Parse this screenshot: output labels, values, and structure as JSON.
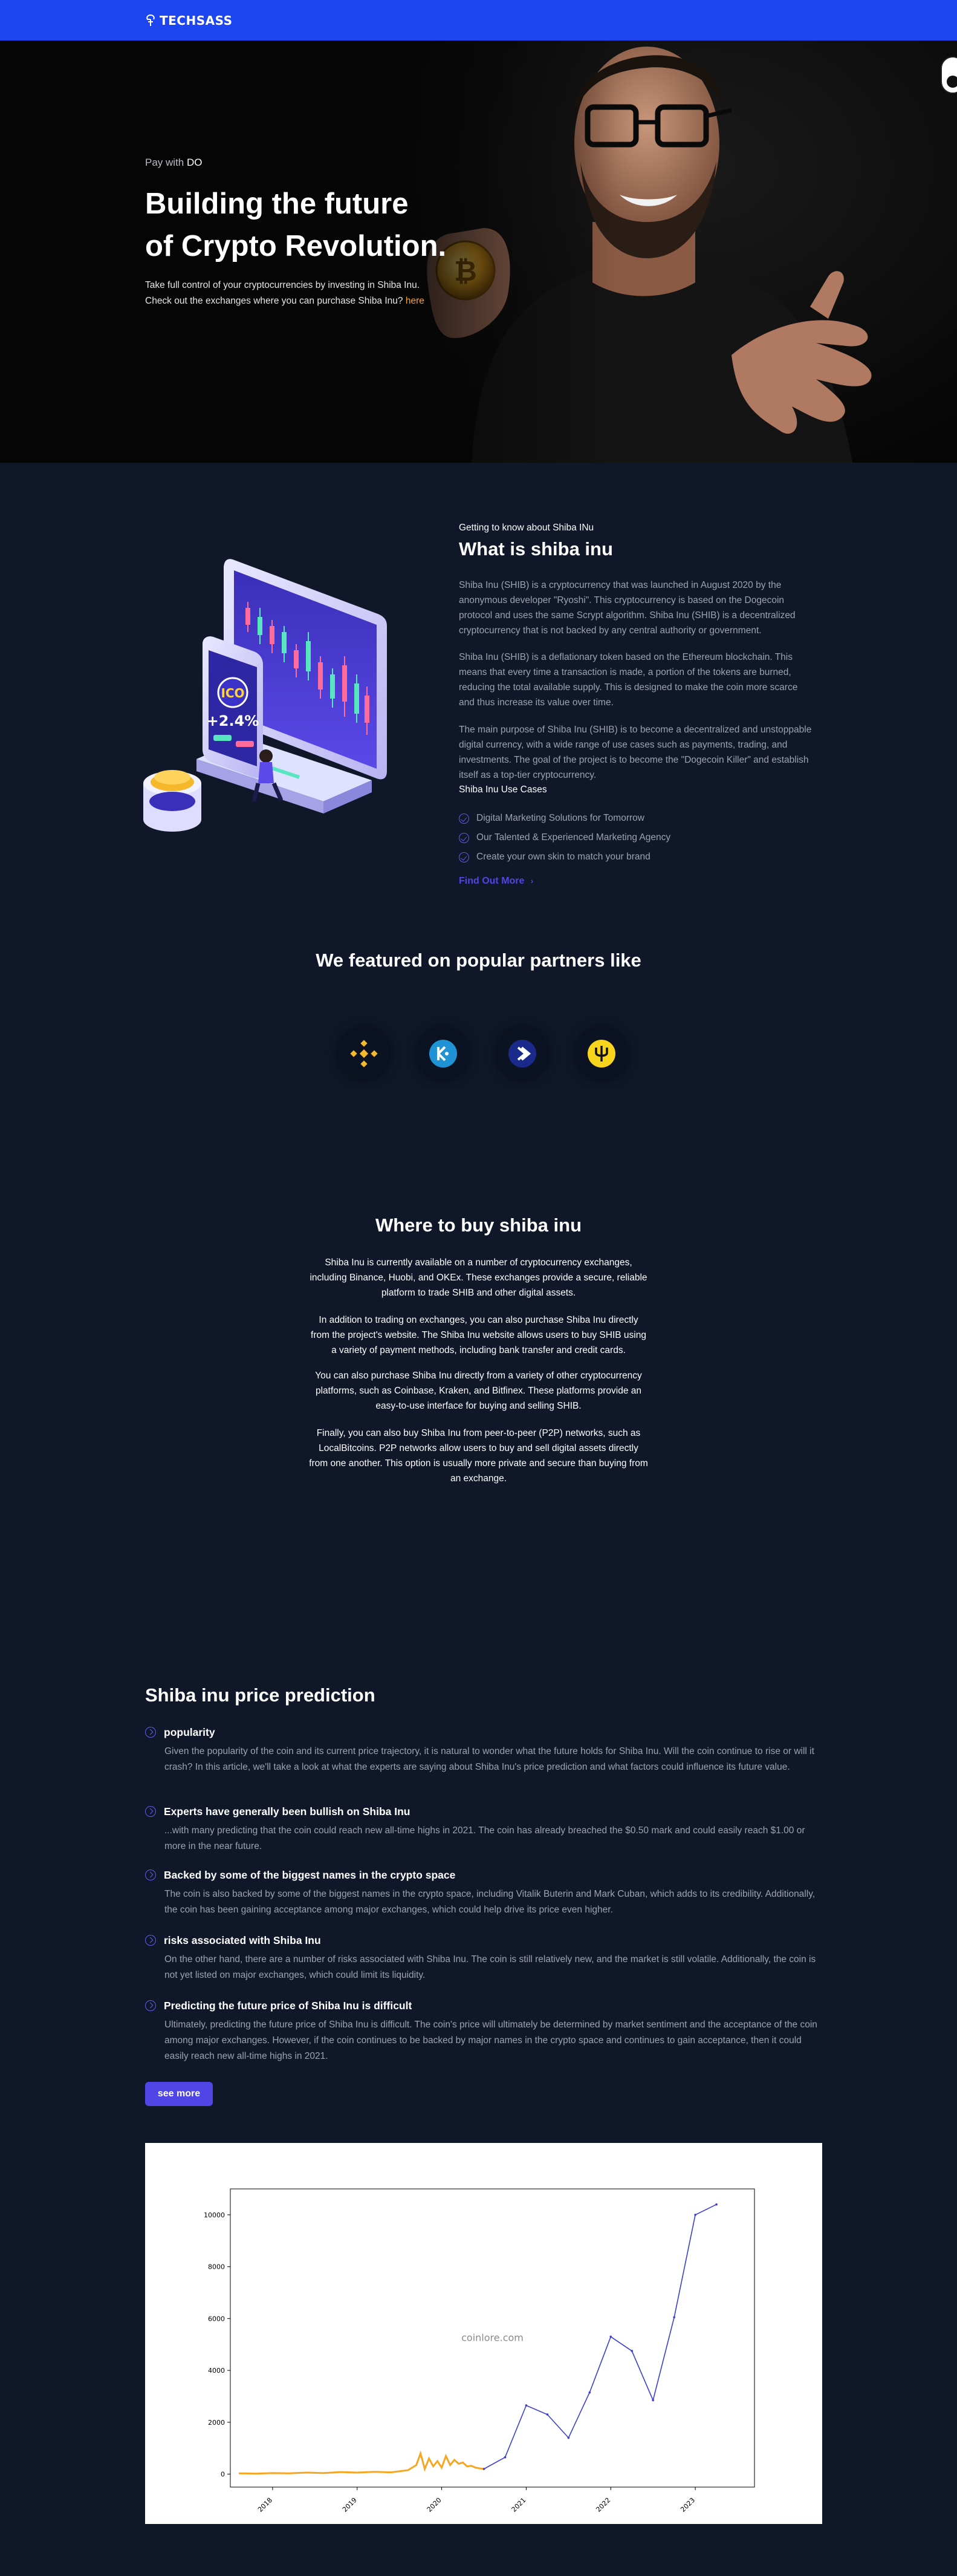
{
  "nav": {
    "brand": "TECHSASS",
    "brand_color": "#1e46f0"
  },
  "hero": {
    "pre_label": "Pay with ",
    "pre_highlight": "DO",
    "title_line1": "Building the future",
    "title_line2": "of Crypto Revolution.",
    "subtitle_line1": "Take full control of your cryptocurrencies by investing in Shiba Inu.",
    "subtitle_line2": "Check out the exchanges where you can purchase Shiba Inu? ",
    "subtitle_link": "here"
  },
  "about": {
    "kicker": "Getting to know about Shiba INu",
    "title": "What is shiba inu",
    "paragraphs": [
      "Shiba Inu (SHIB) is a cryptocurrency that was launched in August 2020 by the anonymous developer \"Ryoshi\". This cryptocurrency is based on the Dogecoin protocol and uses the same Scrypt algorithm. Shiba Inu (SHIB) is a decentralized cryptocurrency that is not backed by any central authority or government.",
      "Shiba Inu (SHIB) is a deflationary token based on the Ethereum blockchain. This means that every time a transaction is made, a portion of the tokens are burned, reducing the total available supply. This is designed to make the coin more scarce and thus increase its value over time.",
      "The main purpose of Shiba Inu (SHIB) is to become a decentralized and unstoppable digital currency, with a wide range of use cases such as payments, trading, and investments. The goal of the project is to become the \"Dogecoin Killer\" and establish itself as a top-tier cryptocurrency."
    ],
    "uses_title": "Shiba Inu Use Cases",
    "uses": [
      "Digital Marketing Solutions for Tomorrow",
      "Our Talented & Experienced Marketing Agency",
      "Create your own skin to match your brand"
    ],
    "find_more": "Find Out More",
    "illustration_badge": "ICO",
    "illustration_percent": "+2.4%"
  },
  "partners": {
    "title": "We featured on popular partners like",
    "items": [
      {
        "name": "binance-icon",
        "color": "#f3ba2f"
      },
      {
        "name": "kucoin-icon",
        "color": "#1f93d6"
      },
      {
        "name": "exchange-chevron-icon",
        "color": "#1a2a8a"
      },
      {
        "name": "trident-icon",
        "color": "#f6d51c"
      }
    ]
  },
  "buy": {
    "title": "Where to buy shiba inu",
    "paragraphs": [
      "Shiba Inu is currently available on a number of cryptocurrency exchanges, including Binance, Huobi, and OKEx. These exchanges provide a secure, reliable platform to trade SHIB and other digital assets.",
      "In addition to trading on exchanges, you can also purchase Shiba Inu directly from the project's website. The Shiba Inu website allows users to buy SHIB using a variety of payment methods, including bank transfer and credit cards.",
      "You can also purchase Shiba Inu directly from a variety of other cryptocurrency platforms, such as Coinbase, Kraken, and Bitfinex. These platforms provide an easy-to-use interface for buying and selling SHIB.",
      "Finally, you can also buy Shiba Inu from peer-to-peer (P2P) networks, such as LocalBitcoins. P2P networks allow users to buy and sell digital assets directly from one another. This option is usually more private and secure than buying from an exchange."
    ]
  },
  "prediction": {
    "title": "Shiba inu price prediction",
    "items": [
      {
        "heading": "popularity",
        "body": "Given the popularity of the coin and its current price trajectory, it is natural to wonder what the future holds for Shiba Inu. Will the coin continue to rise or will it crash? In this article, we'll take a look at what the experts are saying about Shiba Inu's price prediction and what factors could influence its future value."
      },
      {
        "heading": "Experts have generally been bullish on Shiba Inu",
        "body": "...with many predicting that the coin could reach new all-time highs in 2021. The coin has already breached the $0.50 mark and could easily reach $1.00 or more in the near future."
      },
      {
        "heading": "Backed by some of the biggest names in the crypto space",
        "body": "The coin is also backed by some of the biggest names in the crypto space, including Vitalik Buterin and Mark Cuban, which adds to its credibility. Additionally, the coin has been gaining acceptance among major exchanges, which could help drive its price even higher."
      },
      {
        "heading": "risks associated with Shiba Inu",
        "body": "On the other hand, there are a number of risks associated with Shiba Inu. The coin is still relatively new, and the market is still volatile. Additionally, the coin is not yet listed on major exchanges, which could limit its liquidity."
      },
      {
        "heading": "Predicting the future price of Shiba Inu is difficult",
        "body": "Ultimately, predicting the future price of Shiba Inu is difficult. The coin's price will ultimately be determined by market sentiment and the acceptance of the coin among major exchanges. However, if the coin continues to be backed by major names in the crypto space and continues to gain acceptance, then it could easily reach new all-time highs in 2021."
      }
    ],
    "see_more": "see more"
  },
  "chart_data": {
    "type": "line",
    "title": "",
    "xlabel": "",
    "ylabel": "",
    "watermark": "coinlore.com",
    "xlim": [
      2017.5,
      2023.7
    ],
    "ylim": [
      -500,
      11000
    ],
    "yticks": [
      0,
      2000,
      4000,
      6000,
      8000,
      10000
    ],
    "xticks": [
      2018,
      2019,
      2020,
      2021,
      2022,
      2023
    ],
    "xtick_labels": [
      "2018",
      "2019",
      "2020",
      "2021",
      "2022",
      "2023"
    ],
    "series": [
      {
        "color": "#f5a623",
        "x": [
          2017.6,
          2017.8,
          2018.0,
          2018.2,
          2018.4,
          2018.6,
          2018.8,
          2019.0,
          2019.2,
          2019.4,
          2019.6,
          2019.7,
          2019.75,
          2019.8,
          2019.85,
          2019.9,
          2019.95,
          2020.0,
          2020.05,
          2020.1,
          2020.15,
          2020.2,
          2020.25,
          2020.3,
          2020.35,
          2020.4,
          2020.45,
          2020.5
        ],
        "y": [
          30,
          20,
          40,
          30,
          60,
          40,
          80,
          60,
          90,
          70,
          150,
          350,
          800,
          200,
          600,
          300,
          500,
          250,
          700,
          350,
          550,
          400,
          450,
          300,
          320,
          250,
          220,
          200
        ]
      },
      {
        "color": "#3b3fd1",
        "x": [
          2020.5,
          2020.75,
          2021.0,
          2021.25,
          2021.5,
          2021.75,
          2022.0,
          2022.25,
          2022.5,
          2022.75,
          2023.0,
          2023.25
        ],
        "y": [
          200,
          650,
          2650,
          2300,
          1400,
          3150,
          5300,
          4750,
          2850,
          6050,
          10000,
          10400
        ]
      }
    ]
  }
}
